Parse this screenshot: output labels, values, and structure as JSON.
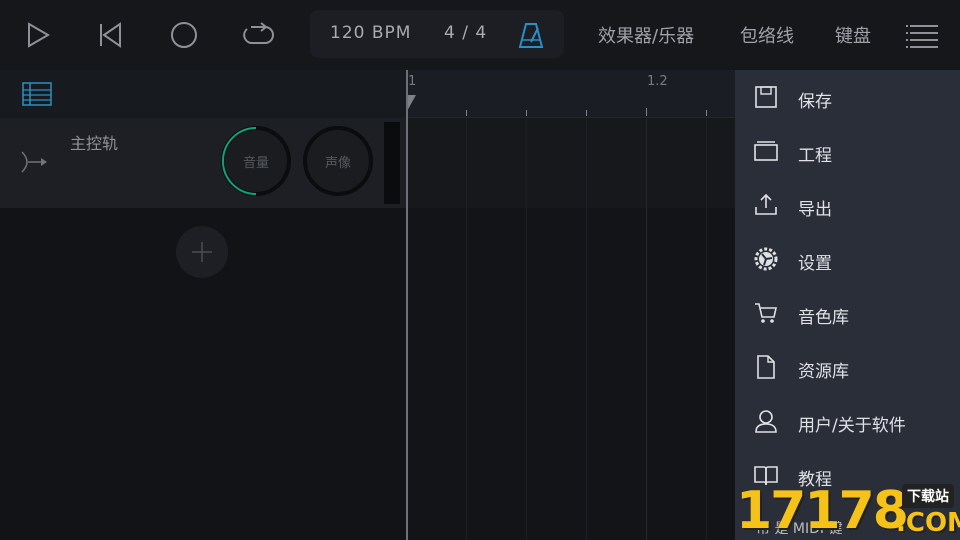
{
  "toolbar": {
    "tempo": "120 BPM",
    "time_signature": "4 / 4",
    "effects_label": "效果器/乐器",
    "envelope_label": "包络线",
    "keyboard_label": "键盘",
    "icons": [
      "play-icon",
      "skip-back-icon",
      "record-icon",
      "loop-icon",
      "metronome-icon",
      "hamburger-menu-icon"
    ]
  },
  "track": {
    "name": "主控轨",
    "volume_label": "音量",
    "pan_label": "声像",
    "volume_level": 0.5
  },
  "timeline": {
    "markers": [
      "1",
      "1.2"
    ]
  },
  "side_menu": {
    "items": [
      {
        "label": "保存",
        "icon": "save-icon"
      },
      {
        "label": "工程",
        "icon": "project-icon"
      },
      {
        "label": "导出",
        "icon": "export-icon"
      },
      {
        "label": "设置",
        "icon": "settings-icon"
      },
      {
        "label": "音色库",
        "icon": "cart-icon"
      },
      {
        "label": "资源库",
        "icon": "file-icon"
      },
      {
        "label": "用户/关于软件",
        "icon": "user-icon"
      },
      {
        "label": "教程",
        "icon": "book-icon"
      }
    ]
  },
  "watermark": {
    "number": "17178",
    "tag": "下载站",
    "domain": ".COM",
    "underlay": "帮   是 MIDI 键"
  },
  "colors": {
    "accent_green": "#0fa37a",
    "menu_bg": "#2a2e39",
    "metronome_blue": "#2a8fc4"
  }
}
